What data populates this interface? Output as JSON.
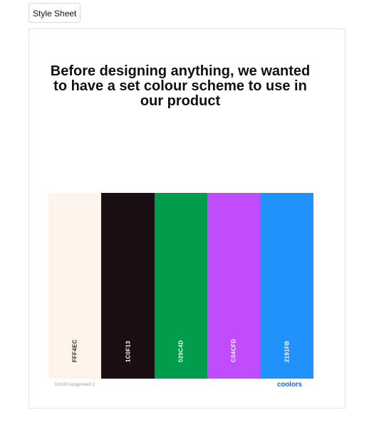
{
  "tab": {
    "label": "Style Sheet"
  },
  "heading": {
    "text": "Before designing anything, we wanted to have a set colour scheme to use in our product"
  },
  "palette": {
    "swatches": [
      {
        "hex_label": "FFF4EC",
        "color": "#FFF4EC",
        "text_color": "#222222"
      },
      {
        "hex_label": "1C0F13",
        "color": "#1C0F13",
        "text_color": "#ffffff"
      },
      {
        "hex_label": "029C4D",
        "color": "#029C4D",
        "text_color": "#ffffff"
      },
      {
        "hex_label": "C04CFD",
        "color": "#C04CFD",
        "text_color": "#ffffff"
      },
      {
        "hex_label": "2191FB",
        "color": "#2191FB",
        "text_color": "#ffffff"
      }
    ]
  },
  "footer": {
    "caption": "DH110 Assignment 2",
    "brand": "coolors",
    "brand_color": "#1F6FE0"
  }
}
